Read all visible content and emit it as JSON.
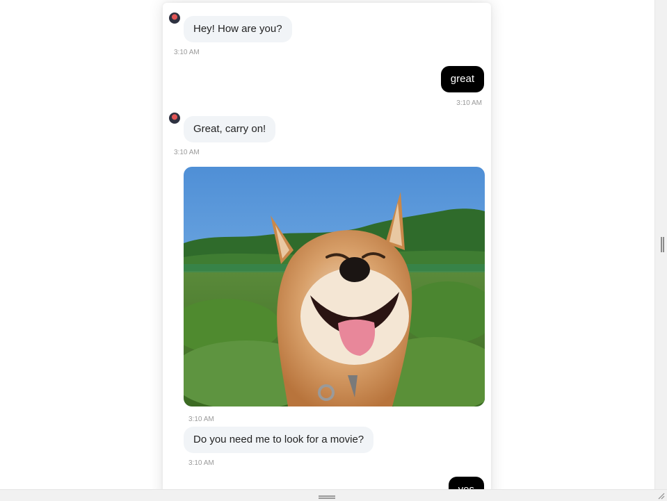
{
  "messages": [
    {
      "sender": "bot",
      "text": "Hey! How are you?",
      "time": "3:10 AM"
    },
    {
      "sender": "user",
      "text": "great",
      "time": "3:10 AM"
    },
    {
      "sender": "bot",
      "text": "Great, carry on!",
      "time": "3:10 AM"
    },
    {
      "sender": "bot",
      "type": "image",
      "image": "smiling-shiba-inu-dog-photo",
      "time": "3:10 AM"
    },
    {
      "sender": "bot",
      "text": "Do you need me to look for a movie?",
      "time": "3:10 AM"
    },
    {
      "sender": "user",
      "text": "yes"
    }
  ],
  "colors": {
    "user_bubble": "#000000",
    "bot_bubble": "#f1f4f7",
    "timestamp": "#9a9a9a"
  }
}
